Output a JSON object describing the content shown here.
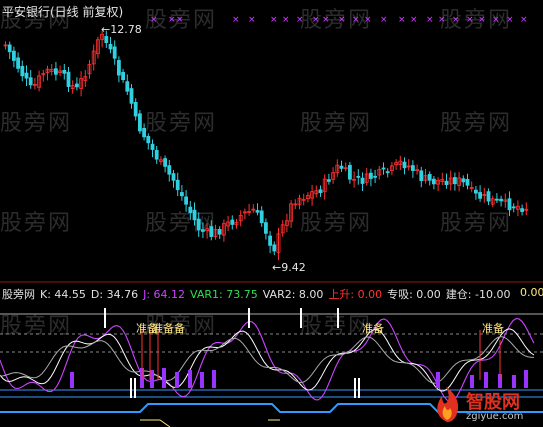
{
  "window": {
    "title": "平安银行(日线 前复权)"
  },
  "watermark": {
    "text": "股旁网"
  },
  "price_chart": {
    "high_label": "12.78",
    "low_label": "9.42"
  },
  "indicator": {
    "name": "股旁网",
    "values": [
      {
        "label": "K: 44.55",
        "color": "#e0e0e0"
      },
      {
        "label": "D: 34.76",
        "color": "#e0e0e0"
      },
      {
        "label": "J: 64.12",
        "color": "#cc44ff"
      },
      {
        "label": "VAR1: 73.75",
        "color": "#33dd55"
      },
      {
        "label": "VAR2: 8.00",
        "color": "#e0e0e0"
      },
      {
        "label": "上升: 0.00",
        "color": "#ff3333"
      },
      {
        "label": "专吸: 0.00",
        "color": "#e0e0e0"
      },
      {
        "label": "建仓: -10.00",
        "color": "#e0e0e0"
      },
      {
        "label": "0.00",
        "color": "#ffe680"
      }
    ],
    "signal_labels": [
      "准备",
      "准备备",
      "准备",
      "准备"
    ]
  },
  "logo": {
    "main": "智股网",
    "sub": "zgiyue.com"
  },
  "colors": {
    "background": "#000000",
    "up_candle": "#ff3030",
    "down_candle": "#30d0e0",
    "k_line": "#ffffff",
    "j_line": "#cc44ff",
    "signal": "#ffe680"
  }
}
